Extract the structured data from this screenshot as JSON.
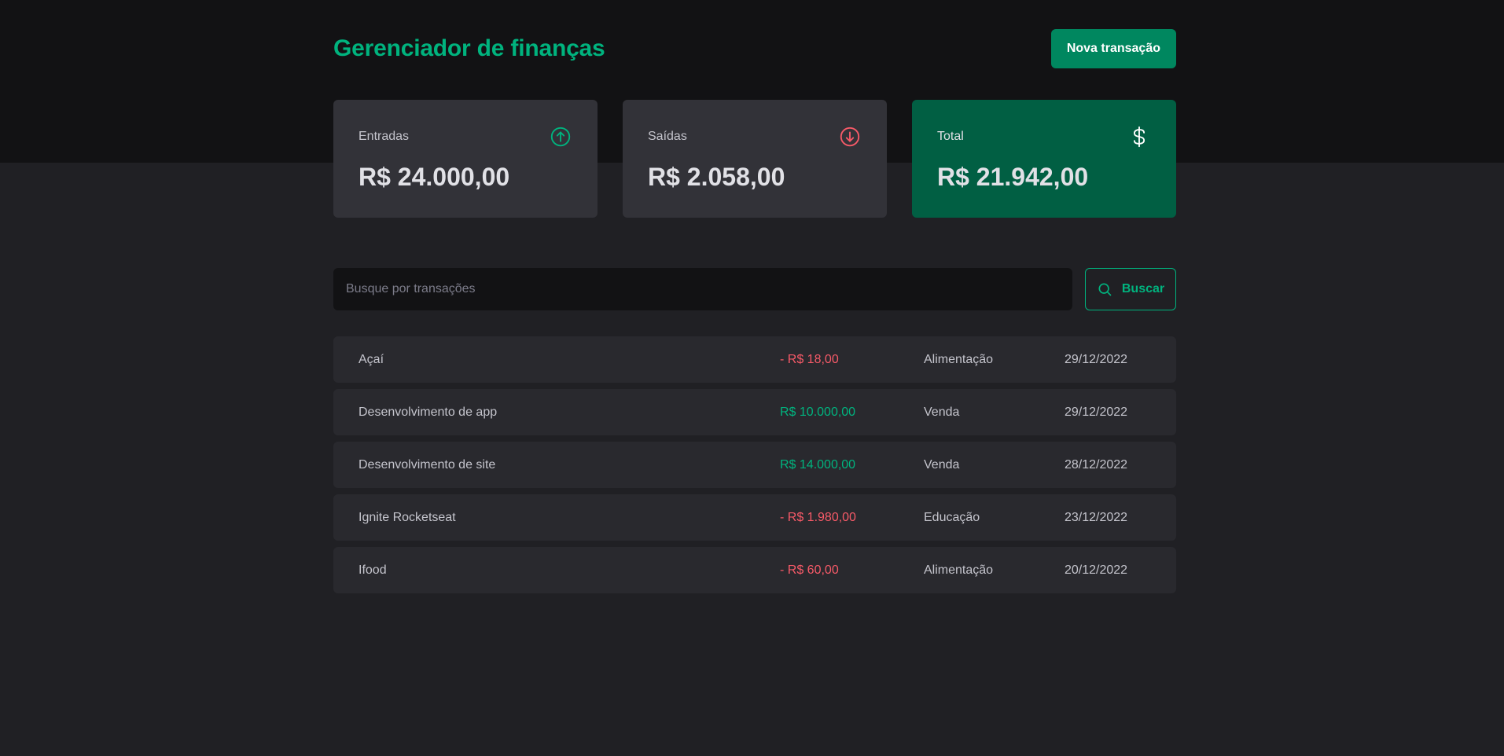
{
  "header": {
    "logo": "Gerenciador de finanças",
    "new_transaction_label": "Nova transação"
  },
  "summary": {
    "income": {
      "label": "Entradas",
      "value": "R$ 24.000,00",
      "icon": "arrow-circle-up-icon"
    },
    "outcome": {
      "label": "Saídas",
      "value": "R$ 2.058,00",
      "icon": "arrow-circle-down-icon"
    },
    "total": {
      "label": "Total",
      "value": "R$ 21.942,00",
      "icon": "currency-dollar-icon"
    }
  },
  "search": {
    "placeholder": "Busque por transações",
    "value": "",
    "button_label": "Buscar"
  },
  "transactions": [
    {
      "description": "Açaí",
      "price": "- R$ 18,00",
      "type": "outcome",
      "category": "Alimentação",
      "date": "29/12/2022"
    },
    {
      "description": "Desenvolvimento de app",
      "price": "R$ 10.000,00",
      "type": "income",
      "category": "Venda",
      "date": "29/12/2022"
    },
    {
      "description": "Desenvolvimento de site",
      "price": "R$ 14.000,00",
      "type": "income",
      "category": "Venda",
      "date": "28/12/2022"
    },
    {
      "description": "Ignite Rocketseat",
      "price": "- R$ 1.980,00",
      "type": "outcome",
      "category": "Educação",
      "date": "23/12/2022"
    },
    {
      "description": "Ifood",
      "price": "- R$ 60,00",
      "type": "outcome",
      "category": "Alimentação",
      "date": "20/12/2022"
    }
  ],
  "colors": {
    "brand": "#00b37e",
    "brand_dark": "#00875f",
    "total_card": "#015f43",
    "income": "#00b37e",
    "outcome": "#f75a68",
    "background": "#202024",
    "header_background": "#121214"
  }
}
